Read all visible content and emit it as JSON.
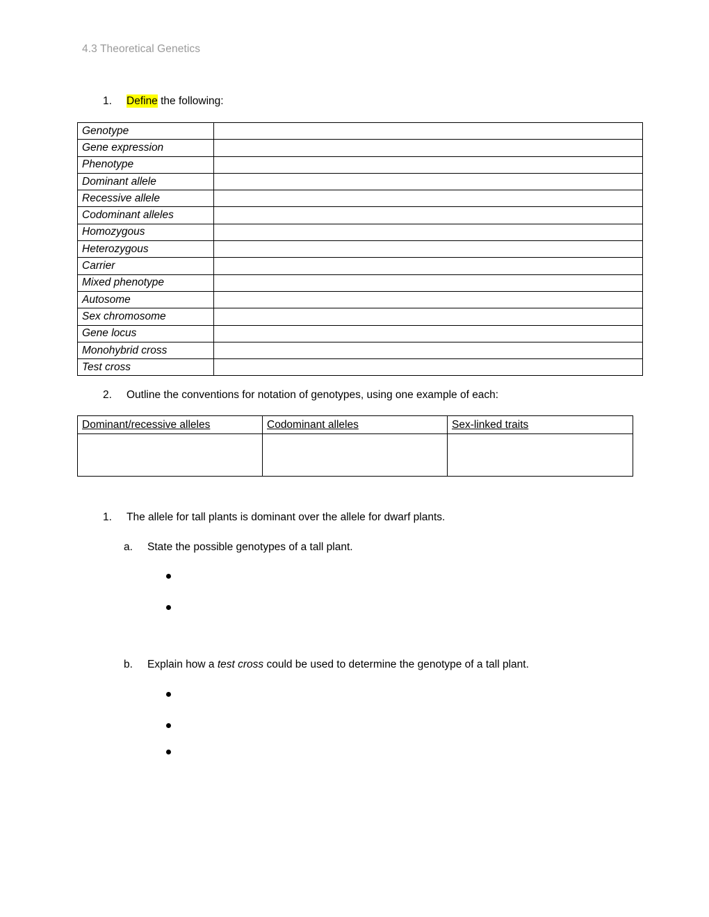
{
  "header": {
    "running_title": "4.3 Theoretical Genetics",
    "color": "#9a9a9a"
  },
  "highlight_color": "#ffff00",
  "question_1": {
    "number": "1.",
    "highlighted_word": "Define",
    "rest": " the following:"
  },
  "definitions_table": {
    "terms": [
      "Genotype",
      "Gene expression",
      "Phenotype",
      "Dominant allele",
      "Recessive allele",
      "Codominant alleles",
      "Homozygous",
      "Heterozygous",
      "Carrier",
      "Mixed phenotype",
      "Autosome",
      "Sex chromosome",
      "Gene locus",
      "Monohybrid cross",
      "Test cross"
    ],
    "answers": [
      "",
      "",
      "",
      "",
      "",
      "",
      "",
      "",
      "",
      "",
      "",
      "",
      "",
      "",
      ""
    ]
  },
  "question_2": {
    "number": "2.",
    "text": "Outline the conventions for notation of genotypes, using one example of each:"
  },
  "conventions_table": {
    "headers": [
      "Dominant/recessive alleles",
      "Codominant alleles",
      "Sex-linked traits"
    ],
    "cells": [
      "",
      "",
      ""
    ]
  },
  "question_3": {
    "number": "1.",
    "text": "The allele for tall plants is dominant over the allele for dwarf plants.",
    "part_a": {
      "marker": "a.",
      "text": "State the possible genotypes of a tall plant.",
      "bullets": [
        "",
        ""
      ]
    },
    "part_b": {
      "marker": "b.",
      "prefix": "Explain how a ",
      "italic": "test cross",
      "suffix": " could be used to determine the genotype of a tall plant.",
      "bullets": [
        "",
        "",
        ""
      ]
    }
  }
}
